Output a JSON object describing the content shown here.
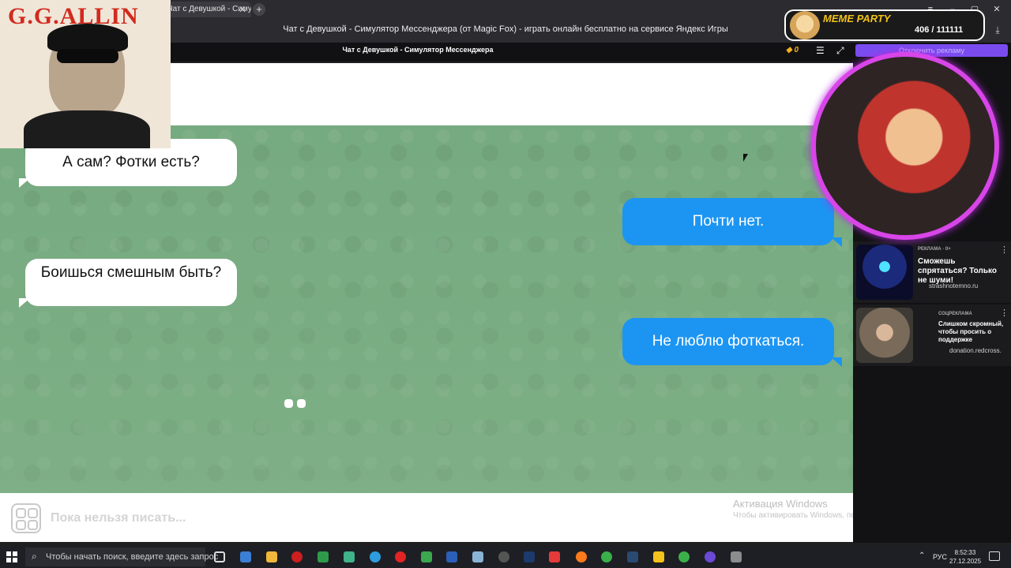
{
  "browser": {
    "tab_title": "Чат с Девушкой - Симу",
    "page_heading": "Чат с Девушкой - Симулятор Мессенджера (от Magic Fox) - играть онлайн бесплатно на сервисе Яндекс Игры"
  },
  "game_header": {
    "title": "Чат с Девушкой - Симулятор Мессенджера",
    "coins": "0",
    "disable_ads": "Отключить рекламу"
  },
  "chat": {
    "messages": [
      {
        "side": "incoming",
        "text": "А сам? Фотки есть?"
      },
      {
        "side": "incoming",
        "text": "Боишься смешным быть?"
      },
      {
        "side": "outgoing",
        "text": "Почти нет."
      },
      {
        "side": "outgoing",
        "text": "Не люблю фоткаться."
      }
    ],
    "input_placeholder": "Пока нельзя писать..."
  },
  "activation": {
    "title": "Активация Windows",
    "subtitle": "Чтобы активировать Windows, перейдите в раздел \"Параметры\"."
  },
  "ads": [
    {
      "label": "РЕКЛАМА · 0+",
      "title": "Сможешь спрятаться? Только не шуми!",
      "source": "strashnotemno.ru"
    },
    {
      "label": "СОЦРЕКЛАМА",
      "title": "Слишком скромный, чтобы просить о поддержке",
      "source": "donation.redcross."
    }
  ],
  "overlays": {
    "photo_caption": "G.G.ALLIN",
    "meme_title": "MEME PARTY",
    "meme_count": "406 / 111111"
  },
  "taskbar": {
    "search_placeholder": "Чтобы начать поиск, введите здесь запрос",
    "lang": "РУС",
    "time": "8:52:33",
    "date": "27.12.2025"
  },
  "colors": {
    "chat_bg": "#76aa80",
    "bubble_incoming": "#ffffff",
    "bubble_outgoing": "#1c95f2",
    "accent_purple": "#7a4cf0"
  }
}
